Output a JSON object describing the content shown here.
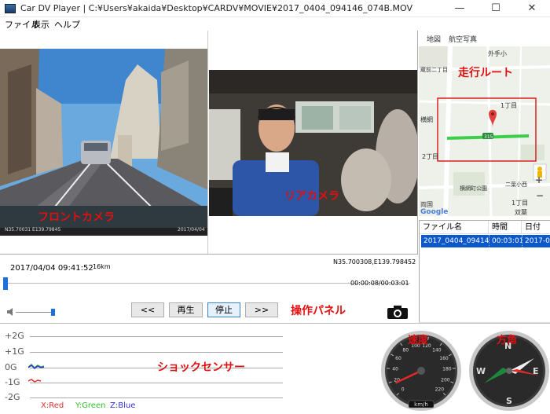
{
  "window": {
    "title": "Car DV Player | C:¥Users¥akaida¥Desktop¥CARDV¥MOVIE¥2017_0404_094146_074B.MOV",
    "minimize": "—",
    "maximize": "☐",
    "close": "✕"
  },
  "menu": [
    "ファイル",
    "表示",
    "ヘルプ"
  ],
  "front_camera": {
    "label": "フロントカメラ",
    "osd": "2017/04/04",
    "osd_left": "N35.70031 E139.79845"
  },
  "rear_camera": {
    "label": "リアカメラ"
  },
  "map": {
    "tabs": [
      "地図",
      "航空写真"
    ],
    "route_label": "走行ルート",
    "road_number": "315",
    "place_labels": [
      "外手小",
      "蔵前二丁目",
      "1丁目",
      "横網",
      "2丁目",
      "二葉小西",
      "横網町公園",
      "1丁目",
      "両国",
      "双葉"
    ],
    "google_logo": "Google",
    "zoom_in": "+",
    "zoom_out": "−",
    "colors": {
      "route": "#3ecf4a",
      "marker": "#e04040",
      "highlight_box": "#e02020"
    }
  },
  "file_list": {
    "headers": [
      "ファイル名",
      "時間",
      "日付"
    ],
    "rows": [
      {
        "name": "2017_0404_09414...",
        "duration": "00:03:01",
        "date": "2017-0"
      }
    ]
  },
  "control_panel": {
    "datetime": "2017/04/04 09:41:52",
    "speed": "16km",
    "coords": "N35.700308,E139.798452",
    "time_progress": "00:00:08/00:03:01",
    "progress_fraction": 0.044,
    "volume_fraction": 0.95,
    "label": "操作パネル",
    "buttons": {
      "rewind": "<<",
      "play": "再生",
      "stop": "停止",
      "forward": ">>"
    },
    "camera_icon": "camera-icon"
  },
  "shock_sensor": {
    "label": "ショックセンサー",
    "levels": [
      "+2G",
      "+1G",
      "0G",
      "-1G",
      "-2G"
    ],
    "axes": [
      "X:Red",
      "Y:Green",
      "Z:Blue"
    ],
    "colors": {
      "x": "#e03030",
      "y": "#30c030",
      "z": "#3030e0"
    }
  },
  "speed_gauge": {
    "label": "速度",
    "ticks": [
      "0",
      "20",
      "40",
      "60",
      "80",
      "100",
      "120",
      "140",
      "160",
      "180",
      "200",
      "220"
    ],
    "unit": "km/h",
    "value": 16
  },
  "compass": {
    "label": "方角",
    "letters": [
      "N",
      "E",
      "S",
      "W"
    ]
  }
}
